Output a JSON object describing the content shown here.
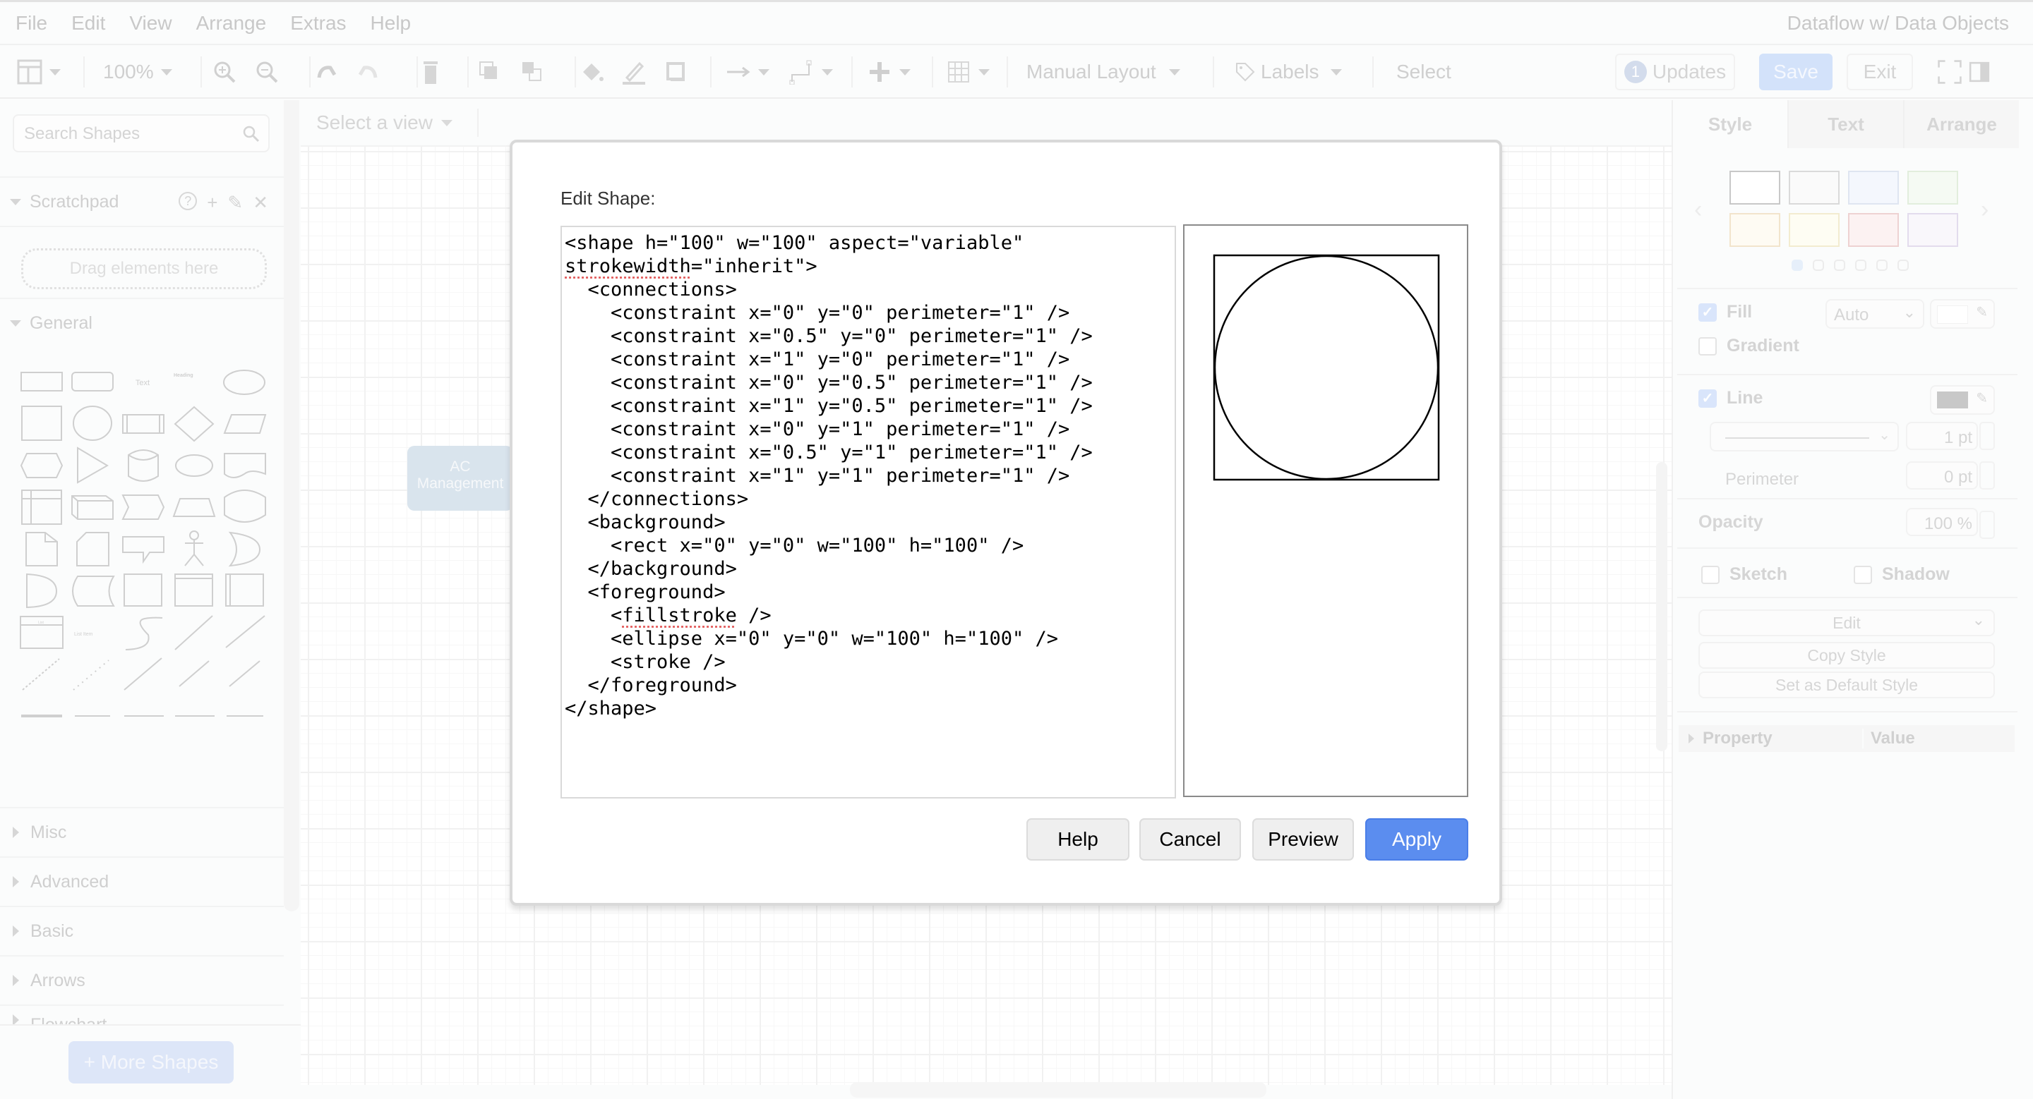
{
  "app": {
    "title": "Dataflow w/ Data Objects",
    "menu": [
      "File",
      "Edit",
      "View",
      "Arrange",
      "Extras",
      "Help"
    ]
  },
  "toolbar": {
    "zoom": "100%",
    "layout": "Manual Layout",
    "labels": "Labels",
    "select": "Select",
    "updates_count": "1",
    "updates_label": "Updates",
    "save": "Save",
    "exit": "Exit"
  },
  "sidebar": {
    "search_placeholder": "Search Shapes",
    "scratchpad": "Scratchpad",
    "dropzone": "Drag elements here",
    "general": "General",
    "shape_text": "Text",
    "shape_heading": "Heading",
    "shape_list_title": "List",
    "shape_list_item": "List Item",
    "collapsed_sections": [
      "Misc",
      "Advanced",
      "Basic",
      "Arrows",
      "Flowchart"
    ],
    "more_shapes": "+ More Shapes"
  },
  "canvas": {
    "view_selector": "Select a view",
    "node_label_line1": "AC",
    "node_label_line2": "Management"
  },
  "format_panel": {
    "tabs": [
      "Style",
      "Text",
      "Arrange"
    ],
    "active_tab": "Style",
    "swatch_colors": [
      "#ffffff",
      "#fafafa",
      "#f4f7fd",
      "#f5faf3",
      "#fefbf3",
      "#fefdf3",
      "#fcf2f2",
      "#f9f7fb"
    ],
    "swatch_borders": [
      "#c8c8c8",
      "#dadada",
      "#dfe5f1",
      "#e2eedd",
      "#f2e4cc",
      "#f3ecd0",
      "#eed2d2",
      "#e3dced"
    ],
    "page_dots": 6,
    "active_dot": 0,
    "fill": {
      "label": "Fill",
      "checked": true,
      "mode": "Auto",
      "color": "#ffffff"
    },
    "gradient": {
      "label": "Gradient",
      "checked": false
    },
    "line": {
      "label": "Line",
      "checked": true,
      "color": "#c8c8c8",
      "width": "1 pt"
    },
    "perimeter": {
      "label": "Perimeter",
      "value": "0 pt"
    },
    "opacity": {
      "label": "Opacity",
      "value": "100 %"
    },
    "sketch": {
      "label": "Sketch",
      "checked": false
    },
    "shadow": {
      "label": "Shadow",
      "checked": false
    },
    "edit_select": "Edit",
    "copy_style": "Copy Style",
    "set_default_style": "Set as Default Style",
    "property_header": "Property",
    "value_header": "Value"
  },
  "dialog": {
    "title": "Edit Shape:",
    "code_lines": [
      "<shape h=\"100\" w=\"100\" aspect=\"variable\"",
      "strokewidth=\"inherit\">",
      "  <connections>",
      "    <constraint x=\"0\" y=\"0\" perimeter=\"1\" />",
      "    <constraint x=\"0.5\" y=\"0\" perimeter=\"1\" />",
      "    <constraint x=\"1\" y=\"0\" perimeter=\"1\" />",
      "    <constraint x=\"0\" y=\"0.5\" perimeter=\"1\" />",
      "    <constraint x=\"1\" y=\"0.5\" perimeter=\"1\" />",
      "    <constraint x=\"0\" y=\"1\" perimeter=\"1\" />",
      "    <constraint x=\"0.5\" y=\"1\" perimeter=\"1\" />",
      "    <constraint x=\"1\" y=\"1\" perimeter=\"1\" />",
      "  </connections>",
      "  <background>",
      "    <rect x=\"0\" y=\"0\" w=\"100\" h=\"100\" />",
      "  </background>",
      "  <foreground>",
      "    <fillstroke />",
      "    <ellipse x=\"0\" y=\"0\" w=\"100\" h=\"100\" />",
      "    <stroke />",
      "  </foreground>",
      "</shape>"
    ],
    "buttons": {
      "help": "Help",
      "cancel": "Cancel",
      "preview": "Preview",
      "apply": "Apply"
    },
    "accent": "#5b8def"
  }
}
